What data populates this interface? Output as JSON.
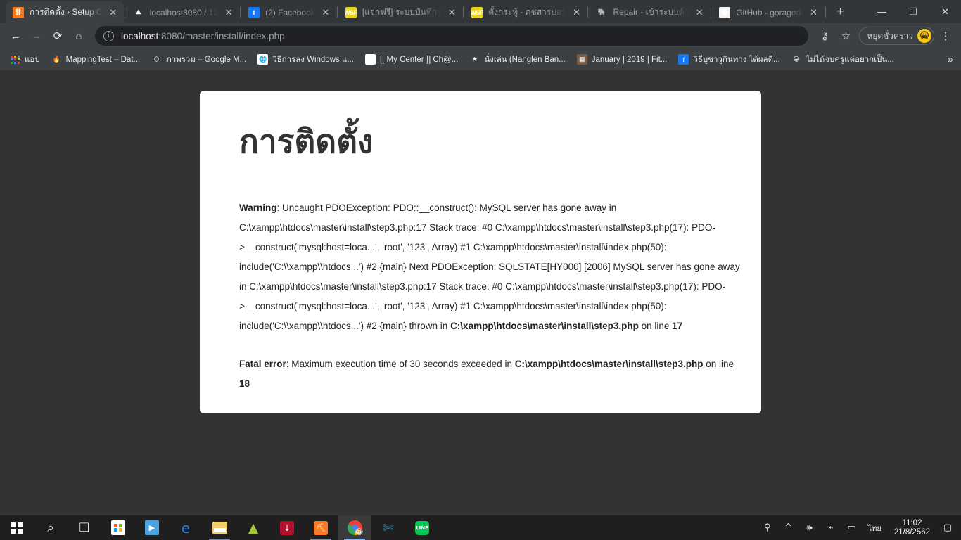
{
  "browser": {
    "tabs": [
      {
        "title": "การติดตั้ง › Setup C",
        "favicon": "xampp-icon",
        "active": true
      },
      {
        "title": "localhost8080 / 12",
        "favicon": "phpmyadmin-icon",
        "active": false
      },
      {
        "title": "(2) Facebook",
        "favicon": "facebook-icon",
        "active": false
      },
      {
        "title": "[แจกฟรี] ระบบบันทึกร",
        "favicon": "wsr-icon",
        "active": false
      },
      {
        "title": "ตั้งกระทู้ - ดชสารบอร์",
        "favicon": "wsr-icon",
        "active": false
      },
      {
        "title": "Repair - เข้าระบบด้ว",
        "favicon": "repair-icon",
        "active": false
      },
      {
        "title": "GitHub - goragod/",
        "favicon": "github-icon",
        "active": false
      }
    ],
    "new_tab_label": "+",
    "close_label": "✕",
    "window_controls": {
      "minimize": "—",
      "maximize": "❐",
      "close": "✕"
    },
    "nav": {
      "back": "←",
      "forward": "→",
      "reload": "⟳",
      "home": "⌂"
    },
    "omnibox": {
      "info_icon": "i",
      "url_host": "localhost",
      "url_rest": ":8080/master/install/index.php",
      "key_icon": "⚷",
      "bookmark_icon": "☆"
    },
    "profile": {
      "label": "หยุดชั่วคราว",
      "avatar_emoji": "😀"
    },
    "menu_icon": "⋮",
    "bookmarks": [
      {
        "label": "แอป",
        "icon": "apps-grid-icon"
      },
      {
        "label": "MappingTest – Dat...",
        "icon": "firebase-icon"
      },
      {
        "label": "ภาพรวม – Google M...",
        "icon": "google-cloud-icon"
      },
      {
        "label": "วิธีการลง Windows แ...",
        "icon": "globe-icon"
      },
      {
        "label": "[[ My Center ]] Ch@...",
        "icon": "mycenter-icon"
      },
      {
        "label": "นั่งเล่น (Nanglen Ban...",
        "icon": "star-icon"
      },
      {
        "label": "January | 2019 | Fit...",
        "icon": "photo-icon"
      },
      {
        "label": "วิธีบูชาวูกินทาง ได้ผลดี...",
        "icon": "facebook-icon"
      },
      {
        "label": "ไม่ได้จบครูแต่อยากเป็น...",
        "icon": "emoji-icon"
      }
    ],
    "bookmarks_overflow": "»"
  },
  "page": {
    "background_color": "#333333",
    "card_background": "#ffffff",
    "heading": "การติดตั้ง",
    "errors": [
      {
        "level": "Warning",
        "prefix": "Warning",
        "body": ": Uncaught PDOException: PDO::__construct(): MySQL server has gone away in C:\\xampp\\htdocs\\master\\install\\step3.php:17 Stack trace: #0 C:\\xampp\\htdocs\\master\\install\\step3.php(17): PDO->__construct('mysql:host=loca...', 'root', '123', Array) #1 C:\\xampp\\htdocs\\master\\install\\index.php(50): include('C:\\\\xampp\\\\htdocs...') #2 {main} Next PDOException: SQLSTATE[HY000] [2006] MySQL server has gone away in C:\\xampp\\htdocs\\master\\install\\step3.php:17 Stack trace: #0 C:\\xampp\\htdocs\\master\\install\\step3.php(17): PDO->__construct('mysql:host=loca...', 'root', '123', Array) #1 C:\\xampp\\htdocs\\master\\install\\index.php(50): include('C:\\\\xampp\\\\htdocs...') #2 {main} thrown in ",
        "file": "C:\\xampp\\htdocs\\master\\install\\step3.php",
        "line_prefix": " on line ",
        "line": "17"
      },
      {
        "level": "Fatal error",
        "prefix": "Fatal error",
        "body": ": Maximum execution time of 30 seconds exceeded in ",
        "file": "C:\\xampp\\htdocs\\master\\install\\step3.php",
        "line_prefix": " on line ",
        "line": "18"
      }
    ]
  },
  "taskbar": {
    "start_label": "Start",
    "items": [
      {
        "name": "start-button",
        "icon": "windows-logo-icon"
      },
      {
        "name": "search-button",
        "icon": "magnifier-icon",
        "glyph": "⌕"
      },
      {
        "name": "task-view-button",
        "icon": "task-view-icon",
        "glyph": "❏"
      },
      {
        "name": "microsoft-store",
        "icon": "store-icon"
      },
      {
        "name": "movies-tv",
        "icon": "movies-icon",
        "glyph": "▶"
      },
      {
        "name": "microsoft-edge",
        "icon": "edge-icon",
        "glyph": "e"
      },
      {
        "name": "file-explorer",
        "icon": "folder-icon"
      },
      {
        "name": "android-studio",
        "icon": "android-icon",
        "glyph": "▲"
      },
      {
        "name": "idm-downloader",
        "icon": "download-icon",
        "glyph": "↓"
      },
      {
        "name": "xampp-control-panel",
        "icon": "xampp-icon",
        "glyph": "⛏"
      },
      {
        "name": "google-chrome",
        "icon": "chrome-icon",
        "emoji": "😀"
      },
      {
        "name": "visual-studio-code",
        "icon": "vscode-icon",
        "glyph": "✄"
      },
      {
        "name": "line-messenger",
        "icon": "line-icon",
        "glyph": "LINE"
      }
    ],
    "tray": {
      "people": "⚲",
      "chevron": "^",
      "volume": "🕪",
      "wifi": "⌁",
      "battery": "▭",
      "language": "ไทย",
      "time": "11:02",
      "date": "21/8/2562",
      "action_center": "▢"
    }
  }
}
